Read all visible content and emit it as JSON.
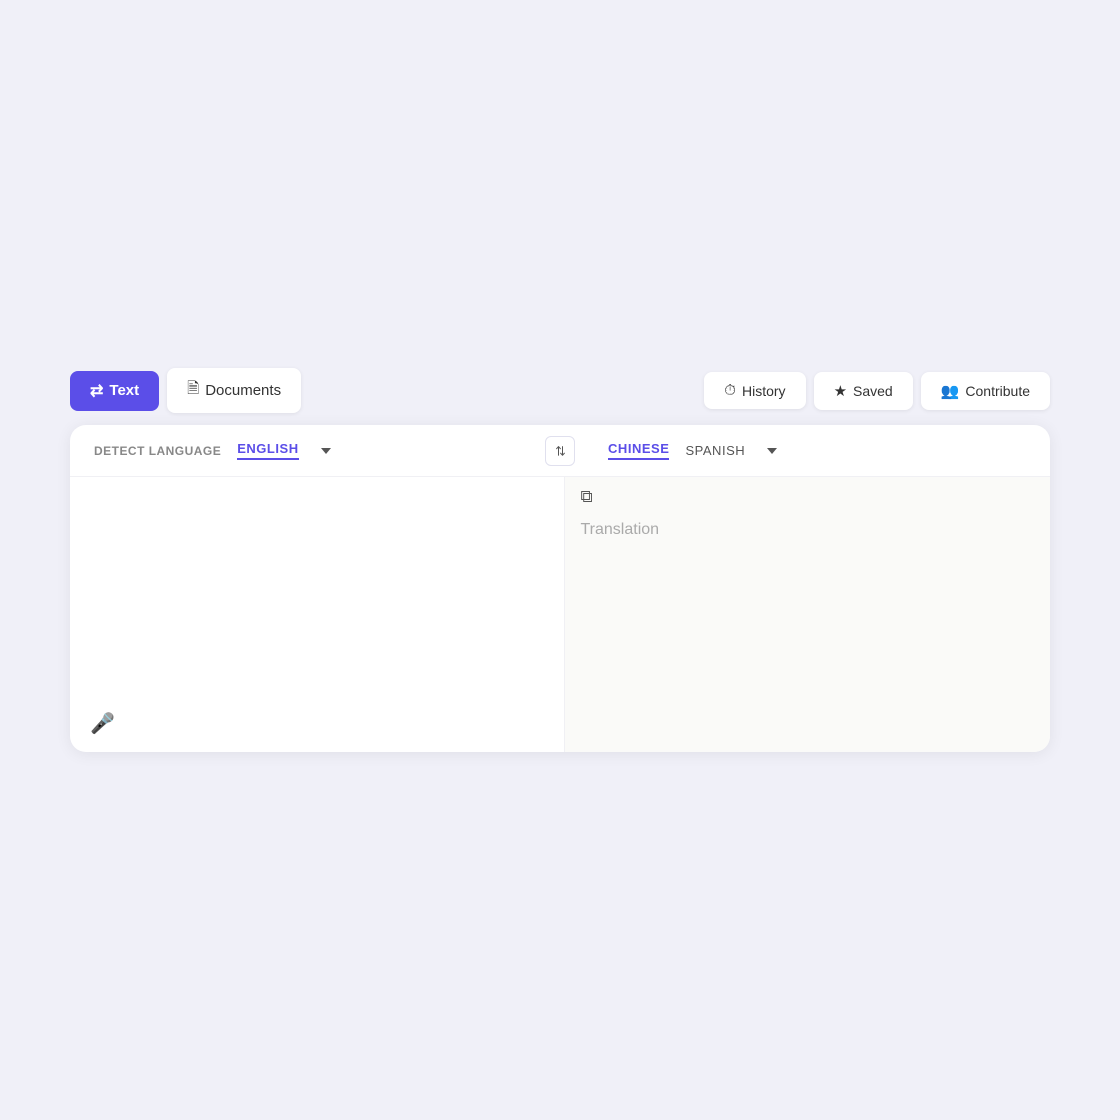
{
  "toolbar": {
    "text_label": "Text",
    "documents_label": "Documents",
    "history_label": "History",
    "saved_label": "Saved",
    "contribute_label": "Contribute"
  },
  "translation": {
    "detect_language": "DETECT LANGUAGE",
    "source_lang": "ENGLISH",
    "target_lang_active": "CHINESE",
    "target_lang_secondary": "SPANISH",
    "input_placeholder": "",
    "output_placeholder": "Translation"
  },
  "icons": {
    "text": "⇄",
    "document": "📄",
    "history": "🕐",
    "saved": "★",
    "contribute": "👥",
    "swap": "⇄",
    "mic": "🎤",
    "copy": "⧉"
  }
}
